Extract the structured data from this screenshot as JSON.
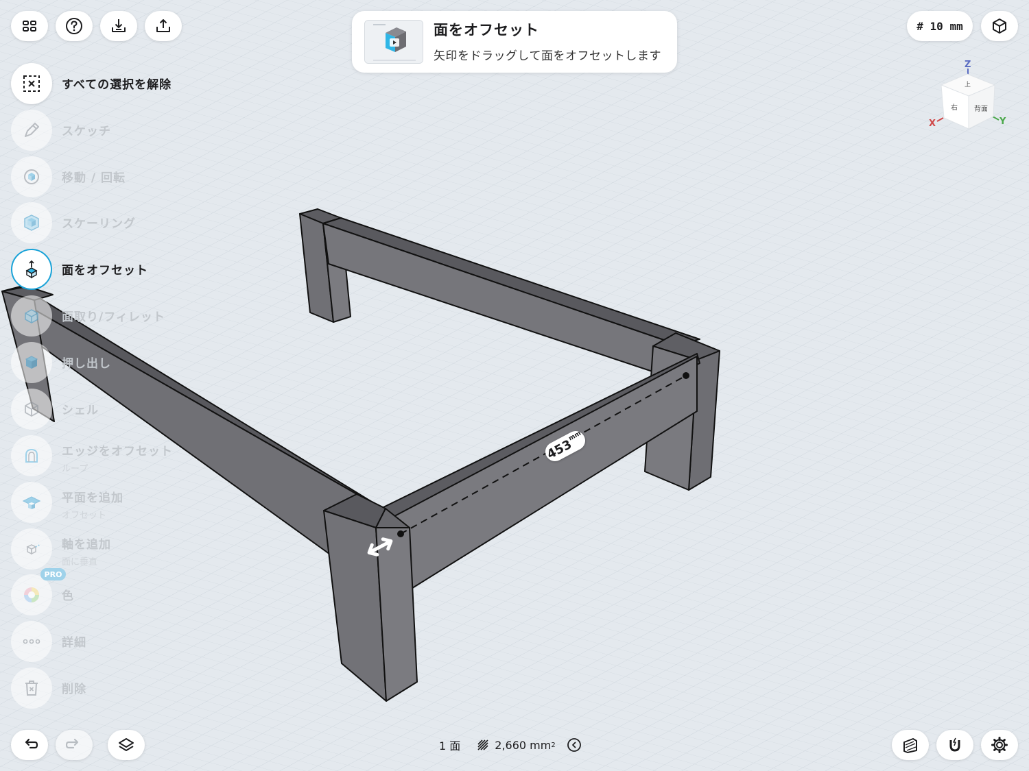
{
  "toolbar": {
    "grid_icon": "grid-icon",
    "help_icon": "help-icon",
    "import_icon": "import-icon",
    "export_icon": "export-icon"
  },
  "hint": {
    "title": "面をオフセット",
    "subtitle": "矢印をドラッグして面をオフセットします"
  },
  "grid_size": "# 10 mm",
  "view_cube": {
    "faces": [
      "上",
      "右",
      "背面"
    ],
    "axes": [
      "Z",
      "X",
      "Y"
    ]
  },
  "tools": [
    {
      "label": "すべての選択を解除",
      "icon": "deselect-icon",
      "state": "on"
    },
    {
      "label": "スケッチ",
      "icon": "sketch-pen-icon",
      "state": "off"
    },
    {
      "label": "移動 / 回転",
      "icon": "move-rotate-icon",
      "state": "off"
    },
    {
      "label": "スケーリング",
      "icon": "scale-cube-icon",
      "state": "off"
    },
    {
      "label": "面をオフセット",
      "icon": "offset-face-icon",
      "state": "selected"
    },
    {
      "label": "面取り/フィレット",
      "icon": "chamfer-icon",
      "state": "off"
    },
    {
      "label": "押し出し",
      "icon": "extrude-icon",
      "state": "off"
    },
    {
      "label": "シェル",
      "icon": "shell-icon",
      "state": "off"
    },
    {
      "label": "エッジをオフセット",
      "sublabel": "ループ",
      "icon": "offset-edge-icon",
      "state": "off"
    },
    {
      "label": "平面を追加",
      "sublabel": "オフセット",
      "icon": "add-plane-icon",
      "state": "off"
    },
    {
      "label": "軸を追加",
      "sublabel": "面に垂直",
      "icon": "add-axis-icon",
      "state": "off"
    },
    {
      "label": "色",
      "icon": "color-wheel-icon",
      "state": "off",
      "badge": "PRO"
    },
    {
      "label": "詳細",
      "icon": "more-dots-icon",
      "state": "off"
    },
    {
      "label": "削除",
      "icon": "trash-icon",
      "state": "off"
    }
  ],
  "dimension": {
    "value": "453",
    "unit": "mm"
  },
  "status": {
    "faces": "1 面",
    "area": "2,660 mm",
    "area_sup": "2"
  },
  "colors": {
    "accent": "#1aa3d8",
    "model_top": "#5e5e63",
    "model_side": "#737378",
    "background": "#e3e8ed"
  }
}
